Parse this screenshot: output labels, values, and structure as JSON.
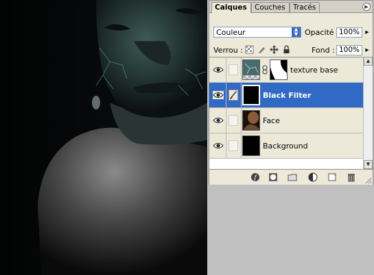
{
  "panel": {
    "tabs": [
      {
        "label": "Calques",
        "active": true
      },
      {
        "label": "Couches",
        "active": false
      },
      {
        "label": "Tracés",
        "active": false
      }
    ],
    "blend_mode": {
      "value": "Couleur"
    },
    "opacity": {
      "label": "Opacité :",
      "value": "100%"
    },
    "lock": {
      "label": "Verrou :"
    },
    "fill": {
      "label": "Fond :",
      "value": "100%"
    },
    "layers": [
      {
        "name": "texture base",
        "visible": true,
        "selected": false,
        "has_mask": true
      },
      {
        "name": "Black Filter",
        "visible": true,
        "selected": true,
        "has_mask": false
      },
      {
        "name": "Face",
        "visible": true,
        "selected": false,
        "has_mask": false
      },
      {
        "name": "Background",
        "visible": true,
        "selected": false,
        "has_mask": false
      }
    ],
    "bottom_icons": [
      "link-layers-icon",
      "layer-style-icon",
      "add-mask-icon",
      "new-group-icon",
      "adjustment-layer-icon",
      "new-layer-icon",
      "delete-layer-icon"
    ],
    "colors": {
      "selection": "#316ac5",
      "panel": "#ece9d8",
      "canvas_bg": "#c0c0c0"
    }
  }
}
